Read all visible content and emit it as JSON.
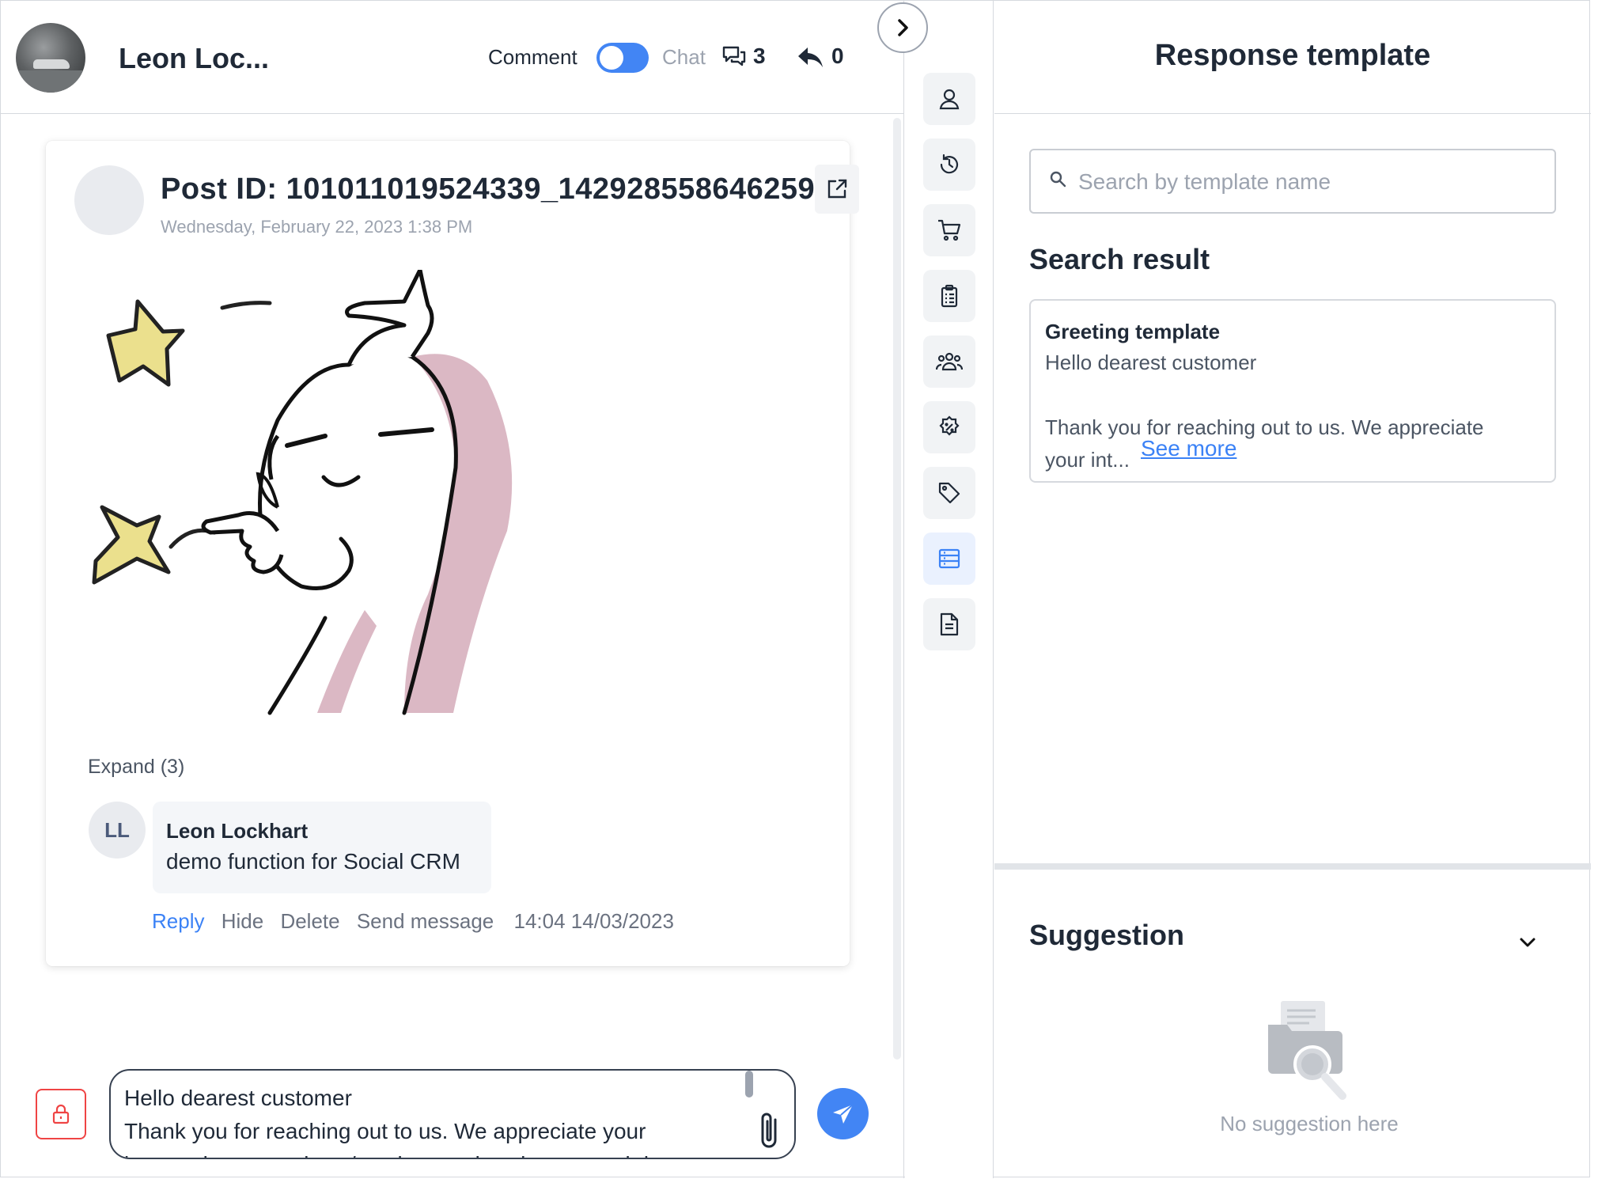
{
  "header": {
    "contact_name": "Leon Loc...",
    "mode_comment_label": "Comment",
    "mode_chat_label": "Chat",
    "comments_count": "3",
    "replies_count": "0"
  },
  "post": {
    "id_label": "Post ID: 101011019524339_142928558646259",
    "date": "Wednesday, February 22, 2023 1:38 PM",
    "expand_label": "Expand (3)"
  },
  "comment": {
    "avatar_initials": "LL",
    "author": "Leon Lockhart",
    "text": "demo function for Social CRM",
    "actions": {
      "reply": "Reply",
      "hide": "Hide",
      "delete": "Delete",
      "send_message": "Send message"
    },
    "timestamp": "14:04 14/03/2023"
  },
  "composer": {
    "text": "Hello dearest customer\nThank you for reaching out to us. We appreciate your\ninterest in our products/services and we have noted down"
  },
  "rail": {
    "icons": [
      "user-icon",
      "history-icon",
      "cart-icon",
      "clipboard-icon",
      "group-icon",
      "badge-percent-icon",
      "tag-icon",
      "template-icon",
      "document-icon"
    ],
    "active": "template-icon"
  },
  "response_template": {
    "title": "Response template",
    "search_placeholder": "Search by template name",
    "results_title": "Search result",
    "results": [
      {
        "name": "Greeting template",
        "preview": "Hello dearest customer\n\nThank you for reaching out to us. We appreciate\nyour int...",
        "see_more": "See more"
      }
    ]
  },
  "suggestion": {
    "title": "Suggestion",
    "empty_text": "No suggestion here"
  },
  "colors": {
    "accent": "#4285f4",
    "danger": "#ef4444",
    "muted": "#9ca3af"
  }
}
